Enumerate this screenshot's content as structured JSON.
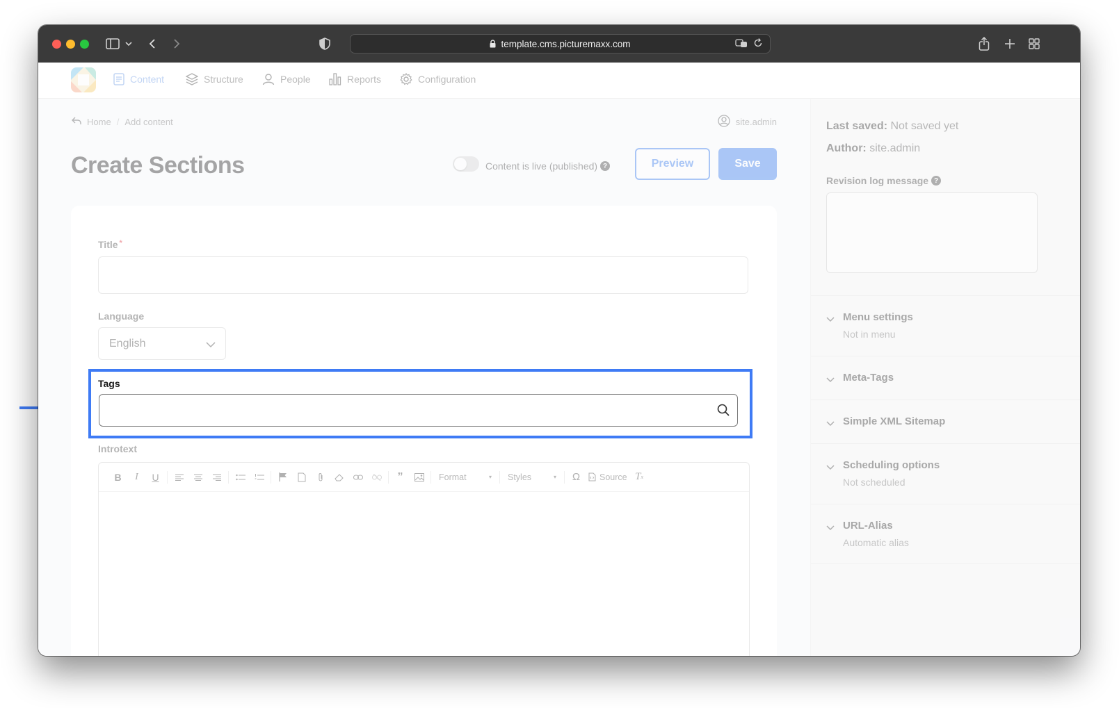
{
  "browser": {
    "url": "template.cms.picturemaxx.com"
  },
  "nav": {
    "items": [
      {
        "label": "Content",
        "icon": "document-icon",
        "active": true
      },
      {
        "label": "Structure",
        "icon": "layers-icon",
        "active": false
      },
      {
        "label": "People",
        "icon": "person-icon",
        "active": false
      },
      {
        "label": "Reports",
        "icon": "bar-chart-icon",
        "active": false
      },
      {
        "label": "Configuration",
        "icon": "gear-icon",
        "active": false
      }
    ]
  },
  "breadcrumb": {
    "home": "Home",
    "separator": "/",
    "current": "Add content"
  },
  "user": {
    "name": "site.admin"
  },
  "page": {
    "title": "Create Sections",
    "live_label": "Content is live (published)",
    "help_glyph": "?",
    "preview_label": "Preview",
    "save_label": "Save"
  },
  "form": {
    "title_label": "Title",
    "required_mark": "*",
    "language_label": "Language",
    "language_value": "English",
    "tags_label": "Tags",
    "introtext_label": "Introtext",
    "toolbar": {
      "format_label": "Format",
      "styles_label": "Styles",
      "source_label": "Source"
    }
  },
  "sidebar": {
    "last_saved_key": "Last saved:",
    "last_saved_value": "Not saved yet",
    "author_key": "Author:",
    "author_value": "site.admin",
    "revision_label": "Revision log message",
    "accordions": [
      {
        "title": "Menu settings",
        "sub": "Not in menu"
      },
      {
        "title": "Meta-Tags",
        "sub": ""
      },
      {
        "title": "Simple XML Sitemap",
        "sub": ""
      },
      {
        "title": "Scheduling options",
        "sub": "Not scheduled"
      },
      {
        "title": "URL-Alias",
        "sub": "Automatic alias"
      }
    ]
  },
  "colors": {
    "accent": "#3f7bf5",
    "button_blue": "#4a88f0",
    "chrome": "#3a3a3a"
  }
}
